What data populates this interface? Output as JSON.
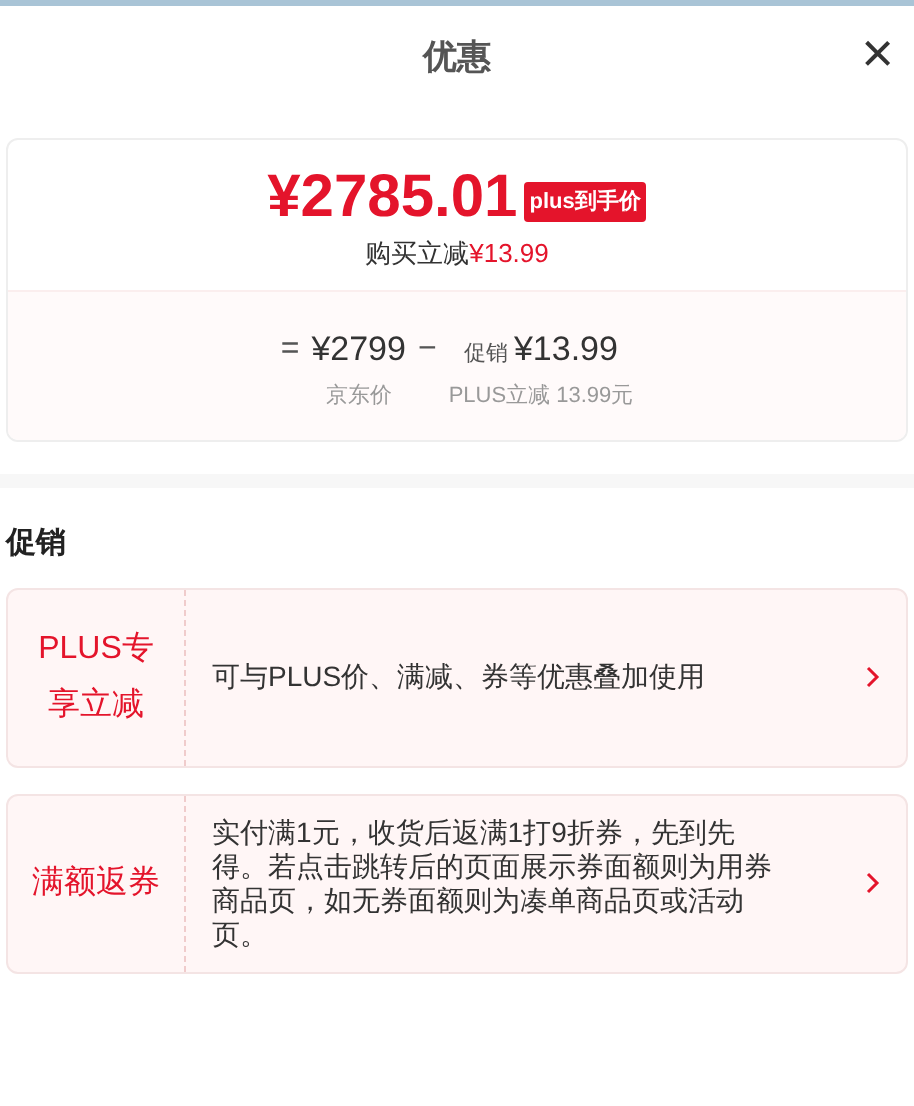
{
  "header": {
    "title": "优惠",
    "close": "×"
  },
  "summary": {
    "price": "¥2785.01",
    "badge": "plus到手价",
    "saving_label": "购买立减",
    "saving_value": "¥13.99",
    "breakdown": [
      {
        "kind": "op",
        "text": "="
      },
      {
        "kind": "amount",
        "text": "¥2799",
        "caption": "京东价"
      },
      {
        "kind": "op",
        "text": "−"
      },
      {
        "kind": "amount",
        "prefix": "促销",
        "text": "¥13.99",
        "caption": "PLUS立减 13.99元"
      }
    ]
  },
  "section_title": "促销",
  "promotions": [
    {
      "tag": "PLUS专享立减",
      "description": "可与PLUS价、满减、券等优惠叠加使用"
    },
    {
      "tag": "满额返券",
      "description": "实付满1元，收货后返满1打9折券，先到先得。若点击跳转后的页面展示券面额则为用券商品页，如无券面额则为凑单商品页或活动页。"
    }
  ]
}
